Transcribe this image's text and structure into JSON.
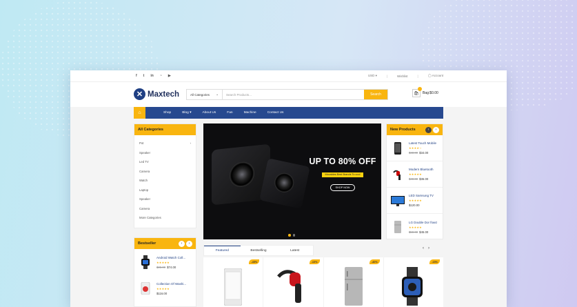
{
  "topbar": {
    "social_icons": [
      "facebook-icon",
      "twitter-icon",
      "linkedin-icon",
      "rss-icon",
      "youtube-icon"
    ],
    "social_glyphs": [
      "f",
      "t",
      "in",
      "◔",
      "▶"
    ],
    "currency": "USD ▾",
    "wishlist": "Wishlist",
    "account": "Account"
  },
  "header": {
    "logo_text": "Maxtech",
    "category_select": "All Categories",
    "search_placeholder": "Search Products...",
    "search_button": "Search",
    "cart_label": "Bag:$0.00"
  },
  "nav": {
    "items": [
      "Shop",
      "Blog ▾",
      "About Us",
      "Fan",
      "Machine",
      "Contact Us"
    ]
  },
  "categories": {
    "title": "All Categories",
    "items": [
      "Pot",
      "Speaker",
      "Led TV",
      "Camera",
      "Watch",
      "Laptop",
      "Speaker",
      "Camera",
      "More Categories"
    ]
  },
  "bestseller": {
    "title": "Bestseller",
    "items": [
      {
        "title": "Android Watch Coll...",
        "stars": "★★★★★",
        "price": "$74.00",
        "old_price": "$85.00"
      },
      {
        "title": "Collection Of Washi...",
        "stars": "★★★★★",
        "price": "$116.00",
        "old_price": ""
      }
    ]
  },
  "hero": {
    "headline": "UP TO 80% OFF",
    "subline": "Movables Best Brands To cool",
    "button": "SHOP NOW"
  },
  "new_products": {
    "title": "New Products",
    "items": [
      {
        "title": "Latest Touch Mobile",
        "stars": "★★★★☆",
        "old_price": "$40.00",
        "price": "$34.00"
      },
      {
        "title": "Modern Bluetooth",
        "stars": "★★★★★",
        "old_price": "$40.00",
        "price": "$36.00"
      },
      {
        "title": "LED Samsung TV",
        "stars": "★★★★★",
        "old_price": "",
        "price": "$120.00"
      },
      {
        "title": "LG Double Dor fraez",
        "stars": "★★★★★",
        "old_price": "$50.00",
        "price": "$45.00"
      }
    ]
  },
  "tabs": [
    "Featured",
    "Bestselling",
    "Latest"
  ],
  "products": [
    {
      "discount": "-45%",
      "kind": "phone"
    },
    {
      "discount": "-10%",
      "kind": "headset"
    },
    {
      "discount": "-40%",
      "kind": "fridge"
    },
    {
      "discount": "-15%",
      "kind": "watch"
    }
  ],
  "colors": {
    "accent": "#f9b50f",
    "brand": "#27498f"
  }
}
